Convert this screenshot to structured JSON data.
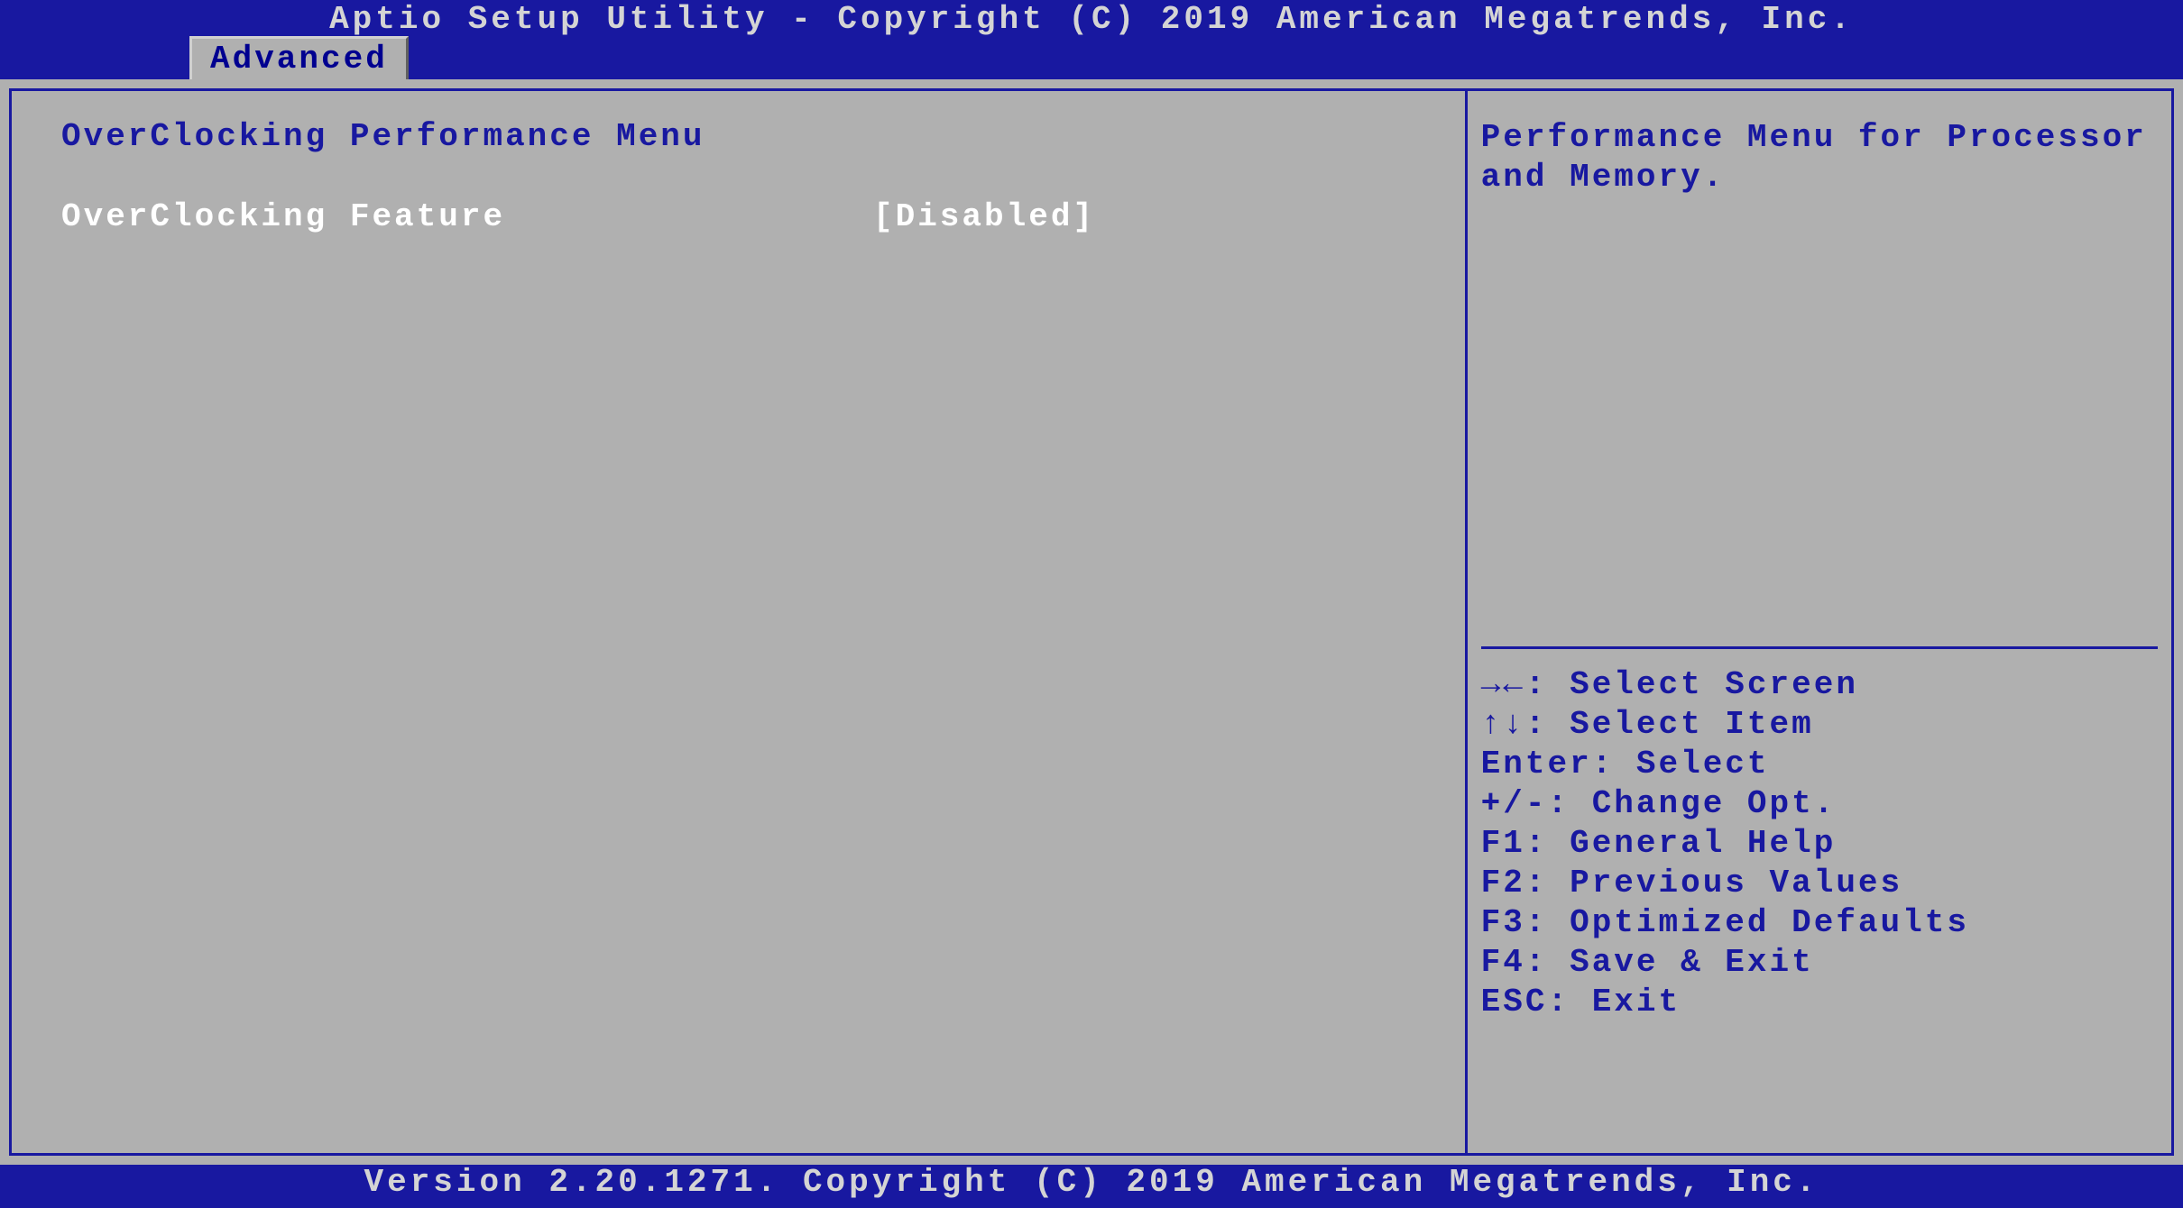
{
  "header": {
    "title": "Aptio Setup Utility - Copyright (C) 2019 American Megatrends, Inc."
  },
  "tabs": {
    "active": "Advanced"
  },
  "main": {
    "title": "OverClocking Performance Menu",
    "items": [
      {
        "label": "OverClocking Feature",
        "value": "[Disabled]"
      }
    ]
  },
  "help": {
    "text": "Performance Menu for Processor and Memory."
  },
  "keys": [
    "→←: Select Screen",
    "↑↓: Select Item",
    "Enter: Select",
    "+/-: Change Opt.",
    "F1: General Help",
    "F2: Previous Values",
    "F3: Optimized Defaults",
    "F4: Save & Exit",
    "ESC: Exit"
  ],
  "footer": {
    "version": "Version 2.20.1271. Copyright (C) 2019 American Megatrends, Inc."
  }
}
